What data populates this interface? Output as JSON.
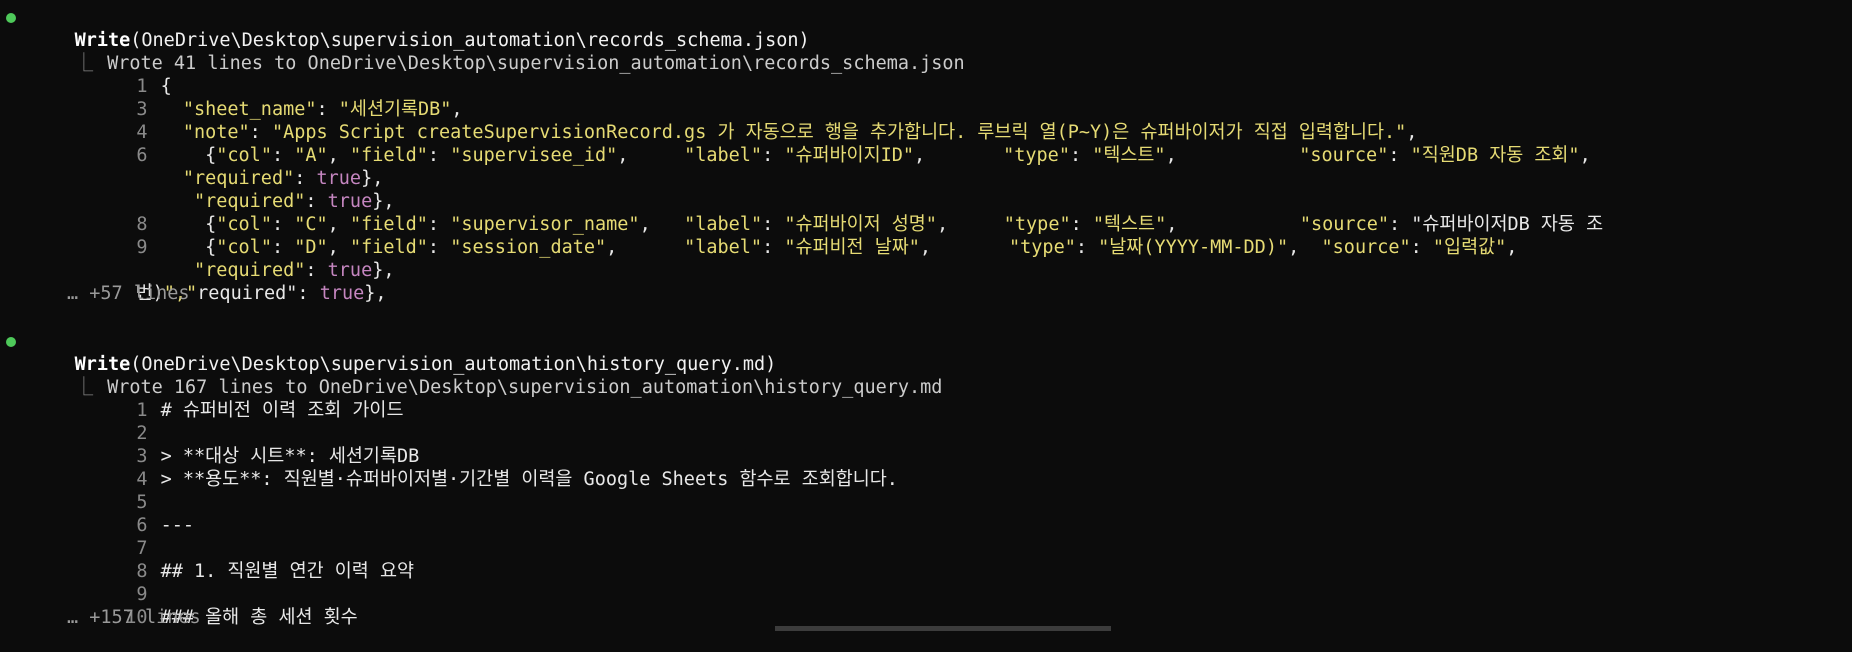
{
  "block1": {
    "tool_name": "Write",
    "tool_arg": "(OneDrive\\Desktop\\supervision_automation\\records_schema.json)",
    "result": "Wrote 41 lines to OneDrive\\Desktop\\supervision_automation\\records_schema.json",
    "lines": [
      {
        "no": "1",
        "text": "{"
      },
      {
        "no": "3",
        "text": "  \"sheet_name\": \"세션기록DB\","
      },
      {
        "no": "4",
        "text": "  \"note\": \"Apps Script createSupervisionRecord.gs 가 자동으로 행을 추가합니다. 루브릭 열(P~Y)은 슈퍼바이저가 직접 입력합니다.\","
      },
      {
        "no": "6",
        "text": "    {\"col\": \"A\", \"field\": \"supervisee_id\",     \"label\": \"슈퍼바이지ID\",       \"type\": \"텍스트\",           \"source\": \"직원DB 자동 조회\","
      },
      {
        "no": "",
        "text": "  \"required\": true},"
      },
      {
        "no": "",
        "text": "   \"required\": true},"
      },
      {
        "no": "8",
        "text": "    {\"col\": \"C\", \"field\": \"supervisor_name\",   \"label\": \"슈퍼바이저 성명\",     \"type\": \"텍스트\",           \"source\": \"슈퍼바이저DB 자동 조"
      },
      {
        "no": "9",
        "text": "    {\"col\": \"D\", \"field\": \"session_date\",      \"label\": \"슈퍼비전 날짜\",       \"type\": \"날짜(YYYY-MM-DD)\",  \"source\": \"입력값\","
      },
      {
        "no": "",
        "text": "   \"required\": true},"
      },
      {
        "no": "",
        "text": "번)\",\"required\": true},"
      }
    ],
    "more": "… +57 lines"
  },
  "block2": {
    "tool_name": "Write",
    "tool_arg": "(OneDrive\\Desktop\\supervision_automation\\history_query.md)",
    "result": "Wrote 167 lines to OneDrive\\Desktop\\supervision_automation\\history_query.md",
    "lines": [
      {
        "no": "1",
        "text": "# 슈퍼비전 이력 조회 가이드"
      },
      {
        "no": "2",
        "text": ""
      },
      {
        "no": "3",
        "text": "> **대상 시트**: 세션기록DB"
      },
      {
        "no": "4",
        "text": "> **용도**: 직원별·슈퍼바이저별·기간별 이력을 Google Sheets 함수로 조회합니다."
      },
      {
        "no": "5",
        "text": ""
      },
      {
        "no": "6",
        "text": "---"
      },
      {
        "no": "7",
        "text": ""
      },
      {
        "no": "8",
        "text": "## 1. 직원별 연간 이력 요약"
      },
      {
        "no": "9",
        "text": ""
      },
      {
        "no": "10",
        "text": "### 올해 총 세션 횟수"
      }
    ],
    "more": "… +157 lines"
  },
  "elbow": "⎿"
}
